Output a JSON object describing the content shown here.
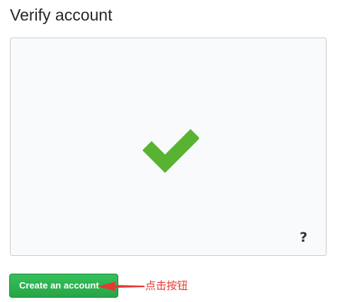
{
  "page": {
    "title": "Verify account"
  },
  "verification": {
    "status_icon": "checkmark-icon",
    "status_color": "#58b332",
    "help_icon": "help-question-icon",
    "help_label": "?"
  },
  "actions": {
    "create_account_label": "Create an account",
    "button_color": "#2ea44f"
  },
  "annotation": {
    "text": "点击按钮",
    "arrow_icon": "red-arrow-icon",
    "color": "#e53935"
  }
}
